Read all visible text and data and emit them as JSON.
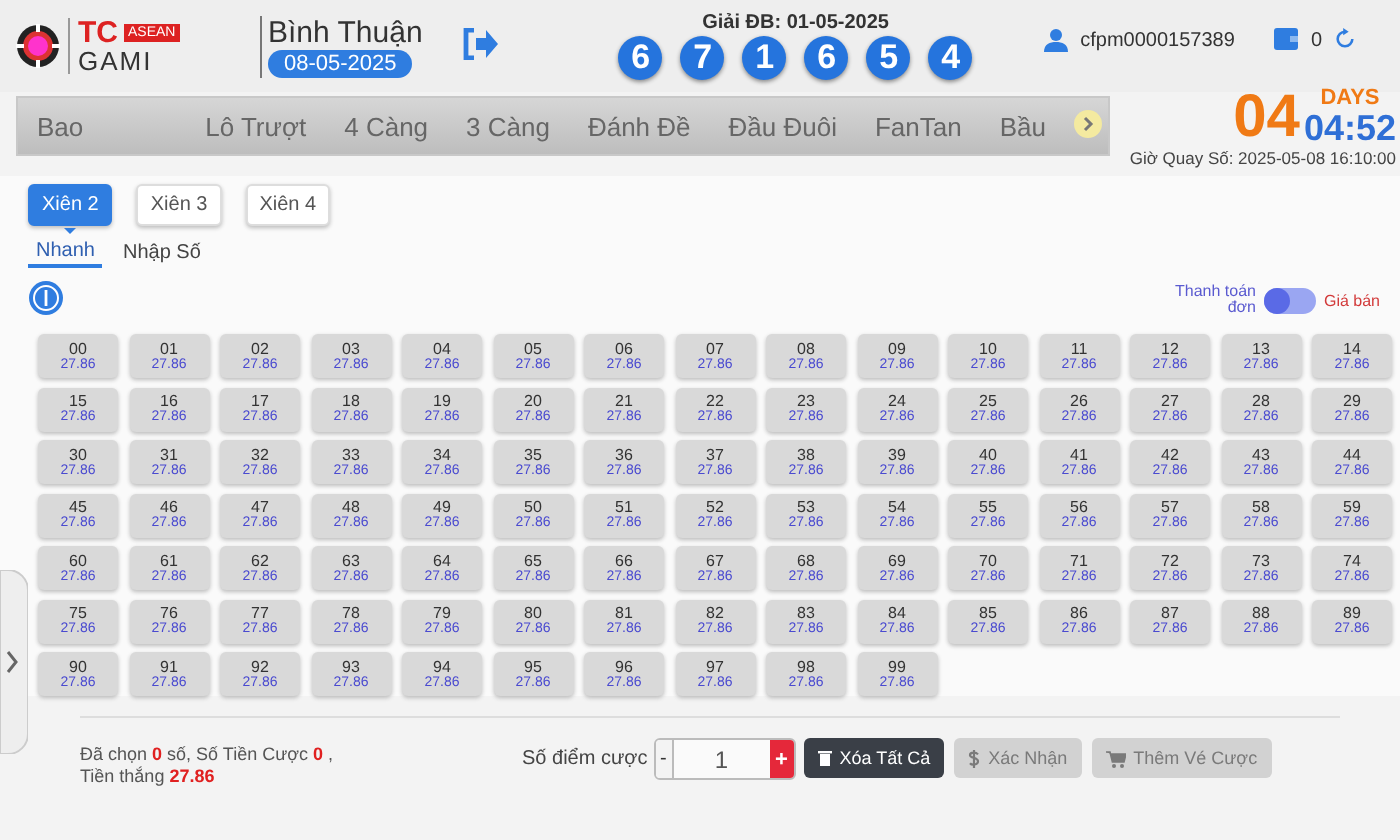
{
  "header": {
    "logo_text": "TC",
    "logo_badge": "ASEAN",
    "logo_subtext": "GAMI",
    "province": "Bình Thuận",
    "date": "08-05-2025",
    "draw_label": "Giải ĐB: 01-05-2025",
    "draw_digits": [
      "6",
      "7",
      "1",
      "6",
      "5",
      "4"
    ],
    "username": "cfpm0000157389",
    "balance": "0",
    "countdown": {
      "days": "04",
      "days_label": "DAYS",
      "time": "04:52",
      "draw_time": "Giờ Quay Số: 2025-05-08 16:10:00"
    }
  },
  "game_tabs": [
    {
      "label": "Bao",
      "selected": false
    },
    {
      "label": "Lô Trượt",
      "selected": false
    },
    {
      "label": "4 Càng",
      "selected": false
    },
    {
      "label": "3 Càng",
      "selected": false
    },
    {
      "label": "Đánh Đề",
      "selected": false
    },
    {
      "label": "Đầu Đuôi",
      "selected": false
    },
    {
      "label": "FanTan",
      "selected": false
    },
    {
      "label": "Bầu",
      "selected": false
    }
  ],
  "sub_tabs": [
    {
      "label": "Xiên 2",
      "selected": true
    },
    {
      "label": "Xiên 3",
      "selected": false
    },
    {
      "label": "Xiên 4",
      "selected": false
    }
  ],
  "mode_tabs": [
    {
      "label": "Nhanh",
      "selected": true
    },
    {
      "label": "Nhập Số",
      "selected": false
    }
  ],
  "price_toggle": {
    "left_label": "Thanh toán đơn",
    "right_label": "Giá bán",
    "on": false
  },
  "numbers": [
    {
      "number": "00",
      "odds": "27.86"
    },
    {
      "number": "01",
      "odds": "27.86"
    },
    {
      "number": "02",
      "odds": "27.86"
    },
    {
      "number": "03",
      "odds": "27.86"
    },
    {
      "number": "04",
      "odds": "27.86"
    },
    {
      "number": "05",
      "odds": "27.86"
    },
    {
      "number": "06",
      "odds": "27.86"
    },
    {
      "number": "07",
      "odds": "27.86"
    },
    {
      "number": "08",
      "odds": "27.86"
    },
    {
      "number": "09",
      "odds": "27.86"
    },
    {
      "number": "10",
      "odds": "27.86"
    },
    {
      "number": "11",
      "odds": "27.86"
    },
    {
      "number": "12",
      "odds": "27.86"
    },
    {
      "number": "13",
      "odds": "27.86"
    },
    {
      "number": "14",
      "odds": "27.86"
    },
    {
      "number": "15",
      "odds": "27.86"
    },
    {
      "number": "16",
      "odds": "27.86"
    },
    {
      "number": "17",
      "odds": "27.86"
    },
    {
      "number": "18",
      "odds": "27.86"
    },
    {
      "number": "19",
      "odds": "27.86"
    },
    {
      "number": "20",
      "odds": "27.86"
    },
    {
      "number": "21",
      "odds": "27.86"
    },
    {
      "number": "22",
      "odds": "27.86"
    },
    {
      "number": "23",
      "odds": "27.86"
    },
    {
      "number": "24",
      "odds": "27.86"
    },
    {
      "number": "25",
      "odds": "27.86"
    },
    {
      "number": "26",
      "odds": "27.86"
    },
    {
      "number": "27",
      "odds": "27.86"
    },
    {
      "number": "28",
      "odds": "27.86"
    },
    {
      "number": "29",
      "odds": "27.86"
    },
    {
      "number": "30",
      "odds": "27.86"
    },
    {
      "number": "31",
      "odds": "27.86"
    },
    {
      "number": "32",
      "odds": "27.86"
    },
    {
      "number": "33",
      "odds": "27.86"
    },
    {
      "number": "34",
      "odds": "27.86"
    },
    {
      "number": "35",
      "odds": "27.86"
    },
    {
      "number": "36",
      "odds": "27.86"
    },
    {
      "number": "37",
      "odds": "27.86"
    },
    {
      "number": "38",
      "odds": "27.86"
    },
    {
      "number": "39",
      "odds": "27.86"
    },
    {
      "number": "40",
      "odds": "27.86"
    },
    {
      "number": "41",
      "odds": "27.86"
    },
    {
      "number": "42",
      "odds": "27.86"
    },
    {
      "number": "43",
      "odds": "27.86"
    },
    {
      "number": "44",
      "odds": "27.86"
    },
    {
      "number": "45",
      "odds": "27.86"
    },
    {
      "number": "46",
      "odds": "27.86"
    },
    {
      "number": "47",
      "odds": "27.86"
    },
    {
      "number": "48",
      "odds": "27.86"
    },
    {
      "number": "49",
      "odds": "27.86"
    },
    {
      "number": "50",
      "odds": "27.86"
    },
    {
      "number": "51",
      "odds": "27.86"
    },
    {
      "number": "52",
      "odds": "27.86"
    },
    {
      "number": "53",
      "odds": "27.86"
    },
    {
      "number": "54",
      "odds": "27.86"
    },
    {
      "number": "55",
      "odds": "27.86"
    },
    {
      "number": "56",
      "odds": "27.86"
    },
    {
      "number": "57",
      "odds": "27.86"
    },
    {
      "number": "58",
      "odds": "27.86"
    },
    {
      "number": "59",
      "odds": "27.86"
    },
    {
      "number": "60",
      "odds": "27.86"
    },
    {
      "number": "61",
      "odds": "27.86"
    },
    {
      "number": "62",
      "odds": "27.86"
    },
    {
      "number": "63",
      "odds": "27.86"
    },
    {
      "number": "64",
      "odds": "27.86"
    },
    {
      "number": "65",
      "odds": "27.86"
    },
    {
      "number": "66",
      "odds": "27.86"
    },
    {
      "number": "67",
      "odds": "27.86"
    },
    {
      "number": "68",
      "odds": "27.86"
    },
    {
      "number": "69",
      "odds": "27.86"
    },
    {
      "number": "70",
      "odds": "27.86"
    },
    {
      "number": "71",
      "odds": "27.86"
    },
    {
      "number": "72",
      "odds": "27.86"
    },
    {
      "number": "73",
      "odds": "27.86"
    },
    {
      "number": "74",
      "odds": "27.86"
    },
    {
      "number": "75",
      "odds": "27.86"
    },
    {
      "number": "76",
      "odds": "27.86"
    },
    {
      "number": "77",
      "odds": "27.86"
    },
    {
      "number": "78",
      "odds": "27.86"
    },
    {
      "number": "79",
      "odds": "27.86"
    },
    {
      "number": "80",
      "odds": "27.86"
    },
    {
      "number": "81",
      "odds": "27.86"
    },
    {
      "number": "82",
      "odds": "27.86"
    },
    {
      "number": "83",
      "odds": "27.86"
    },
    {
      "number": "84",
      "odds": "27.86"
    },
    {
      "number": "85",
      "odds": "27.86"
    },
    {
      "number": "86",
      "odds": "27.86"
    },
    {
      "number": "87",
      "odds": "27.86"
    },
    {
      "number": "88",
      "odds": "27.86"
    },
    {
      "number": "89",
      "odds": "27.86"
    },
    {
      "number": "90",
      "odds": "27.86"
    },
    {
      "number": "91",
      "odds": "27.86"
    },
    {
      "number": "92",
      "odds": "27.86"
    },
    {
      "number": "93",
      "odds": "27.86"
    },
    {
      "number": "94",
      "odds": "27.86"
    },
    {
      "number": "95",
      "odds": "27.86"
    },
    {
      "number": "96",
      "odds": "27.86"
    },
    {
      "number": "97",
      "odds": "27.86"
    },
    {
      "number": "98",
      "odds": "27.86"
    },
    {
      "number": "99",
      "odds": "27.86"
    }
  ],
  "summary": "Đã chọn **0** số,  Số Tiền Cược **0** ,\nTiền thắng **27.86**",
  "stake": {
    "label": "Số điểm cược",
    "minus": "-",
    "value": "1",
    "plus": "+"
  },
  "actions": [
    {
      "label": "Xóa Tất Cả",
      "kind": "delete",
      "disabled": false
    },
    {
      "label": "Xác Nhận",
      "kind": "confirm",
      "disabled": true
    },
    {
      "label": "Thêm Vé Cược",
      "kind": "cart",
      "disabled": true
    }
  ]
}
